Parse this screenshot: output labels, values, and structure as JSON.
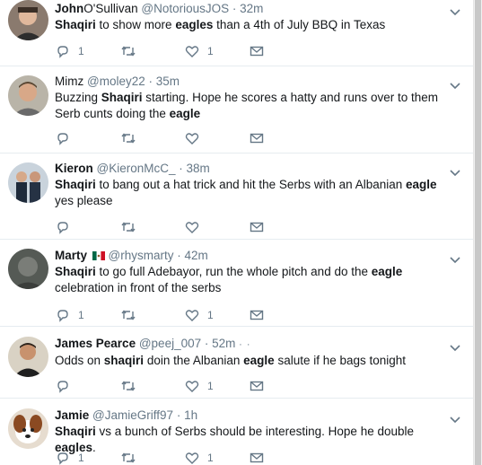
{
  "tweets": [
    {
      "display_name_bold": "John",
      "display_name_rest": "O'Sullivan",
      "handle": "@NotoriousJOS",
      "time": "32m",
      "segments": [
        {
          "t": "Shaqiri",
          "b": true
        },
        {
          "t": " to show more ",
          "b": false
        },
        {
          "t": "eagles",
          "b": true
        },
        {
          "t": " than a 4th of July BBQ in Texas",
          "b": false
        }
      ],
      "reply_count": "1",
      "like_count": "1"
    },
    {
      "display_name_bold": "",
      "display_name_rest": "Mimz",
      "handle": "@moley22",
      "time": "35m",
      "segments": [
        {
          "t": "Buzzing ",
          "b": false
        },
        {
          "t": "Shaqiri",
          "b": true
        },
        {
          "t": " starting. Hope he scores a hatty and runs over to them Serb cunts doing the ",
          "b": false
        },
        {
          "t": "eagle",
          "b": true
        }
      ],
      "reply_count": "",
      "like_count": ""
    },
    {
      "display_name_bold": "Kieron",
      "display_name_rest": "",
      "handle": "@KieronMcC_",
      "time": "38m",
      "segments": [
        {
          "t": "Shaqiri",
          "b": true
        },
        {
          "t": " to bang out a hat trick and hit the Serbs with an Albanian ",
          "b": false
        },
        {
          "t": "eagle",
          "b": true
        },
        {
          "t": " yes please",
          "b": false
        }
      ],
      "reply_count": "",
      "like_count": ""
    },
    {
      "display_name_bold": "Marty",
      "display_name_rest": "",
      "handle": "@rhysmarty",
      "time": "42m",
      "flag": "mexico-flag",
      "segments": [
        {
          "t": "Shaqiri",
          "b": true
        },
        {
          "t": " to go full Adebayor, run the whole pitch and do the ",
          "b": false
        },
        {
          "t": "eagle",
          "b": true
        },
        {
          "t": " celebration in front of the serbs",
          "b": false
        }
      ],
      "reply_count": "1",
      "like_count": "1"
    },
    {
      "display_name_bold": "James Pearce",
      "display_name_rest": "",
      "handle": "@peej_007",
      "time": "52m",
      "dots": "· ·",
      "segments": [
        {
          "t": "Odds on ",
          "b": false
        },
        {
          "t": "shaqiri",
          "b": true
        },
        {
          "t": " doin the Albanian ",
          "b": false
        },
        {
          "t": "eagle",
          "b": true
        },
        {
          "t": " salute if he bags tonight",
          "b": false
        }
      ],
      "reply_count": "",
      "like_count": "1"
    },
    {
      "display_name_bold": "Jamie",
      "display_name_rest": "",
      "handle": "@JamieGriff97",
      "time": "1h",
      "segments": [
        {
          "t": "Shaqiri",
          "b": true
        },
        {
          "t": " vs a bunch of Serbs should be interesting. Hope he double ",
          "b": false
        },
        {
          "t": "eagles",
          "b": true
        },
        {
          "t": ".",
          "b": false
        }
      ],
      "reply_count": "1",
      "like_count": "1"
    }
  ],
  "icons": {
    "reply": "reply-icon",
    "retweet": "retweet-icon",
    "like": "like-icon",
    "dm": "direct-message-icon",
    "more": "chevron-down-icon"
  },
  "colors": {
    "icon": "#657786",
    "text": "#14171a",
    "divider": "#e6ecf0"
  }
}
